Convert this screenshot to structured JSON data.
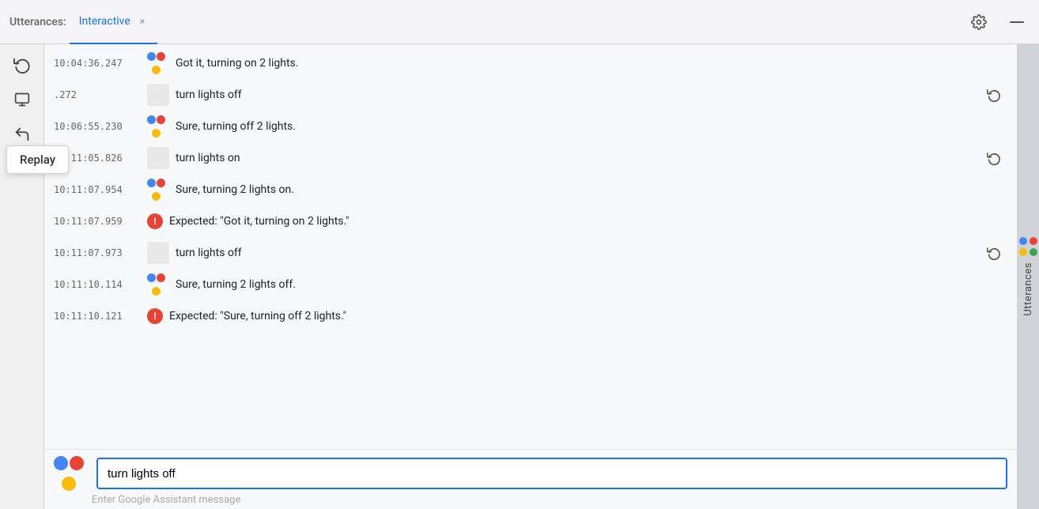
{
  "titleBar": {
    "label": "Utterances:",
    "tab": {
      "name": "Interactive",
      "closeLabel": "×"
    },
    "settingsTitle": "Settings",
    "minimizeTitle": "Minimize"
  },
  "toolbar": {
    "replayLabel": "Replay",
    "replayTooltipVisible": true
  },
  "messages": [
    {
      "id": 1,
      "timestamp": "10:04:36.247",
      "type": "assistant",
      "text": "Got it, turning on 2 lights.",
      "hasReplay": false,
      "hasError": false
    },
    {
      "id": 2,
      "timestamp": ".272",
      "type": "user",
      "text": "turn lights off",
      "hasReplay": true,
      "hasError": false
    },
    {
      "id": 3,
      "timestamp": "10:06:55.230",
      "type": "assistant",
      "text": "Sure, turning off 2 lights.",
      "hasReplay": false,
      "hasError": false
    },
    {
      "id": 4,
      "timestamp": "10:11:05.826",
      "type": "user",
      "text": "turn lights on",
      "hasReplay": true,
      "hasError": false
    },
    {
      "id": 5,
      "timestamp": "10:11:07.954",
      "type": "assistant",
      "text": "Sure, turning 2 lights on.",
      "hasReplay": false,
      "hasError": false
    },
    {
      "id": 6,
      "timestamp": "10:11:07.959",
      "type": "error",
      "text": "Expected: \"Got it, turning on 2 lights.\"",
      "hasReplay": false,
      "hasError": true
    },
    {
      "id": 7,
      "timestamp": "10:11:07.973",
      "type": "user",
      "text": "turn lights off",
      "hasReplay": true,
      "hasError": false
    },
    {
      "id": 8,
      "timestamp": "10:11:10.114",
      "type": "assistant",
      "text": "Sure, turning 2 lights off.",
      "hasReplay": false,
      "hasError": false
    },
    {
      "id": 9,
      "timestamp": "10:11:10.121",
      "type": "error",
      "text": "Expected: \"Sure, turning off 2 lights.\"",
      "hasReplay": false,
      "hasError": true
    }
  ],
  "inputArea": {
    "currentValue": "turn lights off",
    "placeholder": "Enter Google Assistant message"
  },
  "rightSidebar": {
    "label": "Utterances"
  }
}
